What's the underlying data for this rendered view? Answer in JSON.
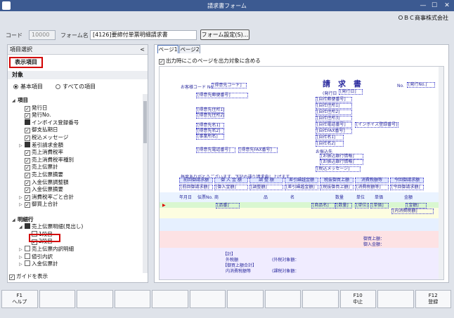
{
  "window": {
    "title": "請求書フォーム"
  },
  "company": "ＯＢＣ商事株式会社",
  "form": {
    "code_label": "コード",
    "code_value": "10000",
    "name_label": "フォーム名",
    "name_value": "[4126]要締付単票明細請求書",
    "settings_button": "フォーム設定(S)..."
  },
  "left_panel": {
    "header": "項目選択",
    "display_tab": "表示項目",
    "target_label": "対象",
    "radio_basic": "基本項目",
    "radio_all": "すべての項目",
    "guide_label": "ガイドを表示"
  },
  "tree": [
    {
      "label": "項目",
      "level": 0,
      "expander": "◢",
      "checkbox": "",
      "bold": true
    },
    {
      "label": "発行日",
      "level": 1,
      "expander": "",
      "checkbox": "on"
    },
    {
      "label": "発行No.",
      "level": 1,
      "expander": "",
      "checkbox": "on"
    },
    {
      "label": "インボイス登録番号",
      "level": 1,
      "expander": "",
      "checkbox": "part"
    },
    {
      "label": "御支払期日",
      "level": 1,
      "expander": "",
      "checkbox": "on"
    },
    {
      "label": "税込メッセージ",
      "level": 1,
      "expander": "",
      "checkbox": "on"
    },
    {
      "label": "差引請求金額",
      "level": 1,
      "expander": "▷",
      "checkbox": "part"
    },
    {
      "label": "売上消費税率",
      "level": 1,
      "expander": "",
      "checkbox": "on"
    },
    {
      "label": "売上消費税率種別",
      "level": 1,
      "expander": "",
      "checkbox": "on"
    },
    {
      "label": "売上伝票計",
      "level": 1,
      "expander": "",
      "checkbox": "on"
    },
    {
      "label": "売上伝票摘要",
      "level": 1,
      "expander": "",
      "checkbox": "on"
    },
    {
      "label": "入金伝票調整額",
      "level": 1,
      "expander": "",
      "checkbox": "on"
    },
    {
      "label": "入金伝票摘要",
      "level": 1,
      "expander": "",
      "checkbox": "on"
    },
    {
      "label": "消費税率ごと合計",
      "level": 1,
      "expander": "▷",
      "checkbox": "on"
    },
    {
      "label": "御買上合計",
      "level": 1,
      "expander": "▷",
      "checkbox": "on"
    },
    {
      "label": "",
      "level": 0,
      "expander": "",
      "checkbox": ""
    },
    {
      "label": "明細行",
      "level": 0,
      "expander": "◢",
      "checkbox": "",
      "bold": true
    },
    {
      "label": "売上伝票明細(見出し)",
      "level": 1,
      "expander": "◢",
      "checkbox": "part"
    },
    {
      "label": "1段目",
      "level": 2,
      "expander": "",
      "checkbox": ""
    },
    {
      "label": "2段目",
      "level": 2,
      "expander": "",
      "checkbox": "on"
    },
    {
      "label": "売上伝票内訳明細",
      "level": 1,
      "expander": "▷",
      "checkbox": ""
    },
    {
      "label": "値引内訳",
      "level": 1,
      "expander": "▷",
      "checkbox": ""
    },
    {
      "label": "入金伝票計",
      "level": 1,
      "expander": "▷",
      "checkbox": ""
    }
  ],
  "right_panel": {
    "tabs": [
      "ページ1",
      "ページ2"
    ],
    "print_option": "出力時にこのページを出力対象に含める"
  },
  "preview": {
    "title": "請　求　書",
    "customer_code": "お客様コード No.",
    "customer_code_field": "[得意先コード]",
    "issue_no": "No.",
    "issue_no_field": "[発行No.]",
    "issue_date_field": "[発行日]",
    "issue_date_label": "(発行日",
    "customer_fields": [
      "[得意先郵便番号]",
      "[得意先住所1]",
      "[得意先住所2]",
      "[得意先名1]",
      "[得意先名2]",
      "[事業所名]"
    ],
    "customer_phone": "[得意先電話番号]",
    "customer_fax": "[得意先FAX番号]",
    "company_fields": [
      "[自社郵便番号]",
      "[自社住所1]",
      "[自社住所2]",
      "[自社住所3]",
      "[自社電話番号]",
      "[インボイス登録番号]",
      "[自社FAX番号]",
      "[自社名1]",
      "[自社名2]"
    ],
    "bank_label": "お振込先",
    "bank_fields": [
      "[お振込銀行情報]",
      "[お振込銀行情報]"
    ],
    "tax_message": "[税込メッセージ]",
    "greeting": "毎度ありがとうございます。下記の通り請求申し上げます。",
    "summary_headers": [
      "前回御請求額",
      "御 入 金 額",
      "調 整 額",
      "差引繰越金額",
      "税抜御買上額",
      "消費税額等",
      "今回御請求額"
    ],
    "summary_fields": [
      "[前回御請求額]",
      "[御入金額]",
      "[調整額]",
      "[差引繰越金額]",
      "[税抜御買上額]",
      "[消費税額等]",
      "[今回御請求額]"
    ],
    "table_headers": [
      "年月日",
      "伝票No.",
      "商",
      "品",
      "名",
      "数量",
      "単位",
      "単価",
      "金額"
    ],
    "row_fields": [
      "[品番]",
      "[商品名]",
      "[数量]",
      "[単位]",
      "[単価]",
      "[金額]",
      "[内消費税額]"
    ],
    "summary_labels": [
      "【計】",
      "外税額",
      "(外税対象額：",
      "【御買上額合計】",
      "内消費税額等",
      "(課税対象額："
    ],
    "side_labels": [
      "御買上額：",
      "御入金額："
    ]
  },
  "fkeys": [
    {
      "key": "F1",
      "label": "ヘルプ"
    },
    {
      "key": "",
      "label": ""
    },
    {
      "key": "",
      "label": ""
    },
    {
      "key": "",
      "label": ""
    },
    {
      "key": "",
      "label": ""
    },
    {
      "key": "",
      "label": ""
    },
    {
      "key": "",
      "label": ""
    },
    {
      "key": "",
      "label": ""
    },
    {
      "key": "",
      "label": ""
    },
    {
      "key": "F10",
      "label": "中止"
    },
    {
      "key": "",
      "label": ""
    },
    {
      "key": "F12",
      "label": "登録"
    }
  ],
  "colors": {
    "titlebar": "#3c5a91",
    "highlight": "#d20000",
    "preview_ink": "#2b2b9e"
  }
}
